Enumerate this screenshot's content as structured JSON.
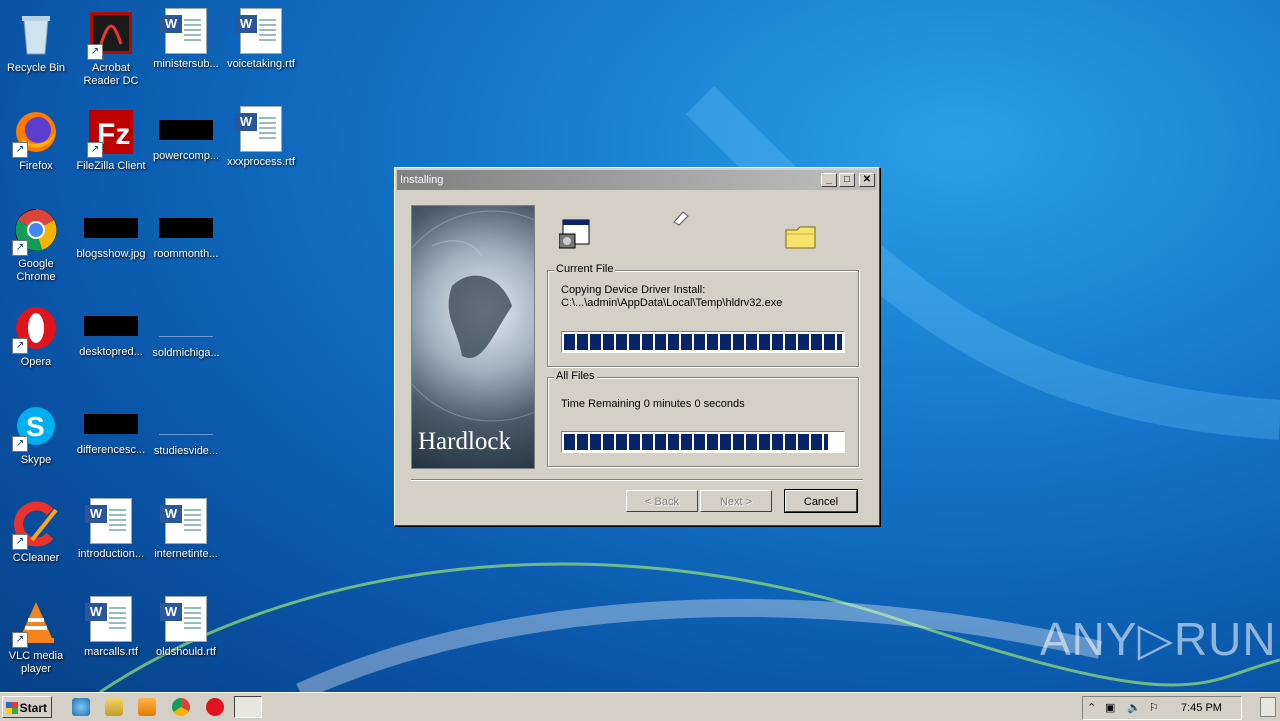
{
  "desktop": {
    "icons": [
      {
        "label": "Recycle Bin"
      },
      {
        "label": "Acrobat\nReader DC"
      },
      {
        "label": "ministersub..."
      },
      {
        "label": "voicetaking.rtf"
      },
      {
        "label": "Firefox"
      },
      {
        "label": "FileZilla Client"
      },
      {
        "label": "powercomp..."
      },
      {
        "label": "xxxprocess.rtf"
      },
      {
        "label": "Google\nChrome"
      },
      {
        "label": "blogsshow.jpg"
      },
      {
        "label": "roommonth..."
      },
      {
        "label": "Opera"
      },
      {
        "label": "desktopred..."
      },
      {
        "label": "soldmichiga..."
      },
      {
        "label": "Skype"
      },
      {
        "label": "differencesc..."
      },
      {
        "label": "studiesvide..."
      },
      {
        "label": "CCleaner"
      },
      {
        "label": "introduction..."
      },
      {
        "label": "internetinte..."
      },
      {
        "label": "VLC media\nplayer"
      },
      {
        "label": "marcalls.rtf"
      },
      {
        "label": "oldshould.rtf"
      }
    ]
  },
  "window": {
    "title": "Installing",
    "brand_text": "Hardlock",
    "current_file": {
      "legend": "Current File",
      "line1": "Copying Device Driver Install:",
      "line2": "C:\\...\\admin\\AppData\\Local\\Temp\\hldrv32.exe",
      "progress": 1.0
    },
    "all_files": {
      "legend": "All Files",
      "line1": "Time Remaining 0 minutes 0 seconds",
      "progress": 0.95
    },
    "buttons": {
      "back": "< Back",
      "next": "Next >",
      "cancel": "Cancel"
    }
  },
  "taskbar": {
    "start_label": "Start",
    "clock": "7:45 PM"
  },
  "watermark": "ANY▷RUN"
}
